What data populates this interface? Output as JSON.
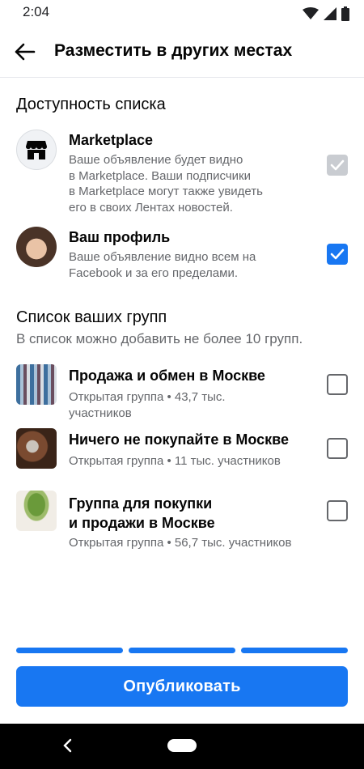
{
  "status_bar": {
    "time": "2:04"
  },
  "header": {
    "title": "Разместить в других местах"
  },
  "availability": {
    "title": "Доступность списка",
    "marketplace": {
      "title": "Marketplace",
      "description_lines": [
        "Ваше объявление будет видно",
        "в Marketplace. Ваши подписчики",
        "в Marketplace могут также увидеть",
        "его в своих Лентах новостей."
      ],
      "checked": true,
      "disabled": true
    },
    "profile": {
      "title": "Ваш профиль",
      "description_lines": [
        "Ваше объявление видно всем на",
        "Facebook и за его пределами."
      ],
      "checked": true
    }
  },
  "groups": {
    "title": "Список ваших групп",
    "subtitle": "В список можно добавить не более 10 групп.",
    "items": [
      {
        "title": "Продажа и обмен в Москве",
        "sub_lines": [
          "Открытая группа • 43,7 тыс.",
          "участников"
        ],
        "checked": false
      },
      {
        "title": "Ничего не покупайте в Москве",
        "sub_lines": [
          "Открытая группа • 11 тыс. участников"
        ],
        "checked": false
      },
      {
        "title_lines": [
          "Группа для покупки",
          "и продажи в Москве"
        ],
        "sub_lines": [
          "Открытая группа • 56,7 тыс. участников"
        ],
        "checked": false
      }
    ]
  },
  "progress": {
    "steps": 3,
    "completed": 3
  },
  "publish_button": {
    "label": "Опубликовать"
  },
  "colors": {
    "accent": "#1877f2",
    "muted_text": "#65676b",
    "disabled_checkbox": "#c9ccd1"
  },
  "icons": [
    "back-arrow-icon",
    "store-icon",
    "checkmark-icon",
    "wifi-icon",
    "cellular-icon",
    "battery-icon",
    "nav-back-icon"
  ]
}
